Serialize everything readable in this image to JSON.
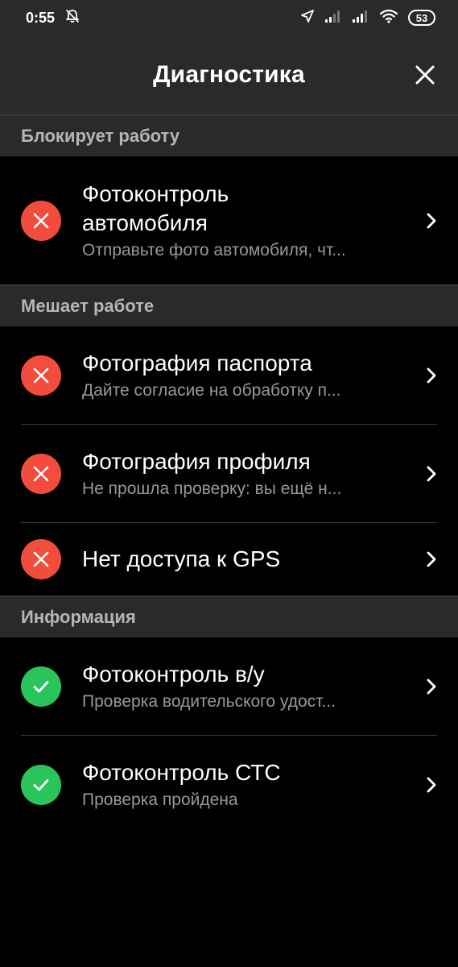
{
  "status_bar": {
    "time": "0:55",
    "battery": "53",
    "icons": [
      "muted-alarm-icon",
      "location-arrow-icon",
      "signal-icon",
      "signal-icon",
      "wifi-icon",
      "battery-icon"
    ]
  },
  "app_bar": {
    "title": "Диагностика",
    "close_icon": "close-icon"
  },
  "sections": [
    {
      "header": "Блокирует работу",
      "items": [
        {
          "title_line1": "Фотоконтроль",
          "title_line2": "автомобиля",
          "subtitle": "Отправьте фото автомобиля, чт...",
          "status": "error"
        }
      ]
    },
    {
      "header": "Мешает работе",
      "items": [
        {
          "title": "Фотография паспорта",
          "subtitle": "Дайте согласие на обработку п...",
          "status": "error"
        },
        {
          "title": "Фотография профиля",
          "subtitle": "Не прошла проверку: вы ещё н...",
          "status": "error"
        },
        {
          "title": "Нет доступа к GPS",
          "subtitle": "",
          "status": "error"
        }
      ]
    },
    {
      "header": "Информация",
      "items": [
        {
          "title": "Фотоконтроль в/у",
          "subtitle": "Проверка водительского удост...",
          "status": "ok"
        },
        {
          "title": "Фотоконтроль СТС",
          "subtitle": "Проверка пройдена",
          "status": "ok"
        }
      ]
    }
  ],
  "colors": {
    "background": "#000000",
    "bar": "#2b2a29",
    "error": "#f24d3c",
    "ok": "#29c55a",
    "subtitle": "#9a9896",
    "section_header": "#b8b6b3"
  }
}
